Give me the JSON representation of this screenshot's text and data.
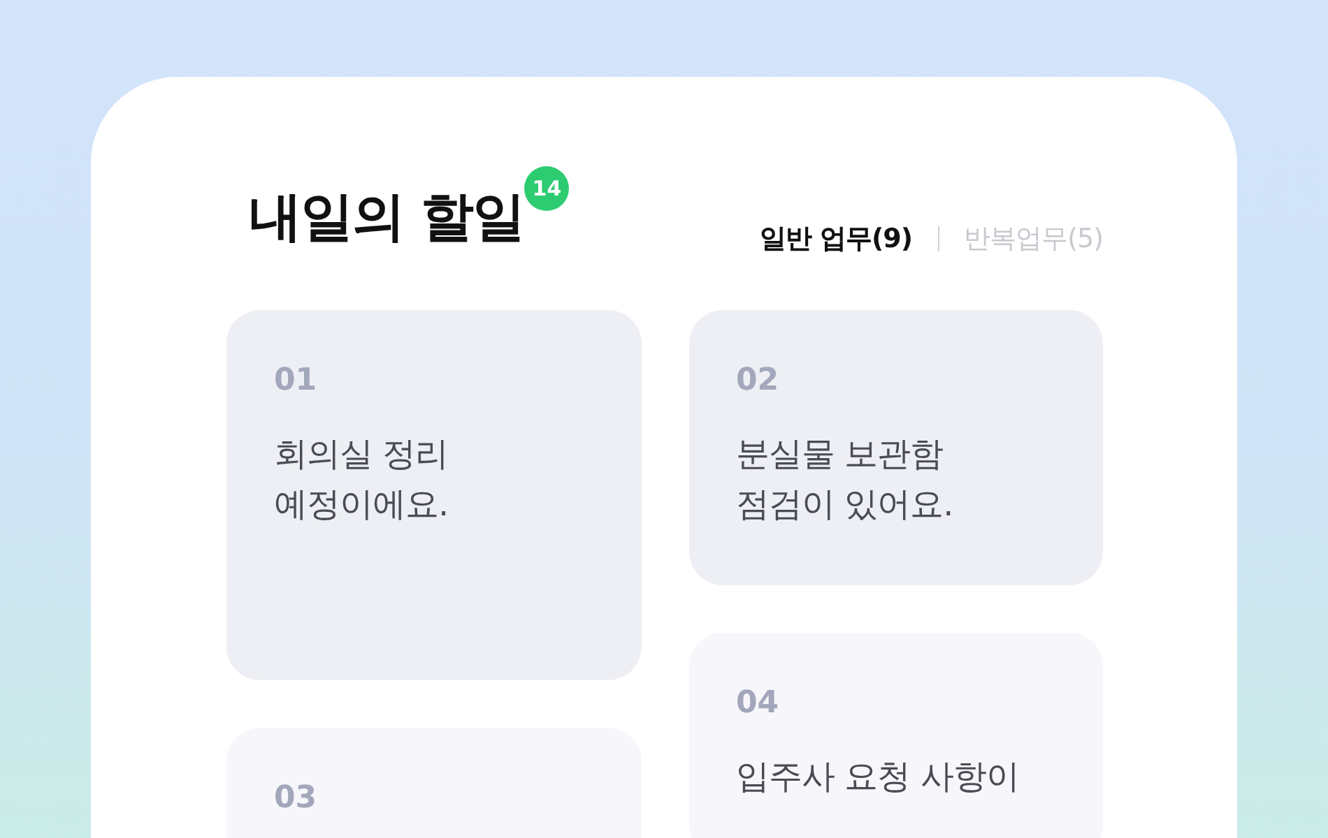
{
  "header": {
    "title": "내일의 할일",
    "count_badge": "14"
  },
  "tabs": [
    {
      "label": "일반 업무(9)",
      "selected": true
    },
    {
      "label": "반복업무(5)",
      "selected": false
    }
  ],
  "tasks": [
    {
      "number": "01",
      "text": "회의실 정리\n예정이에요."
    },
    {
      "number": "03"
    },
    {
      "number": "02",
      "text": "분실물 보관함\n점검이 있어요."
    },
    {
      "number": "04",
      "text": "입주사 요청 사항이"
    }
  ]
}
